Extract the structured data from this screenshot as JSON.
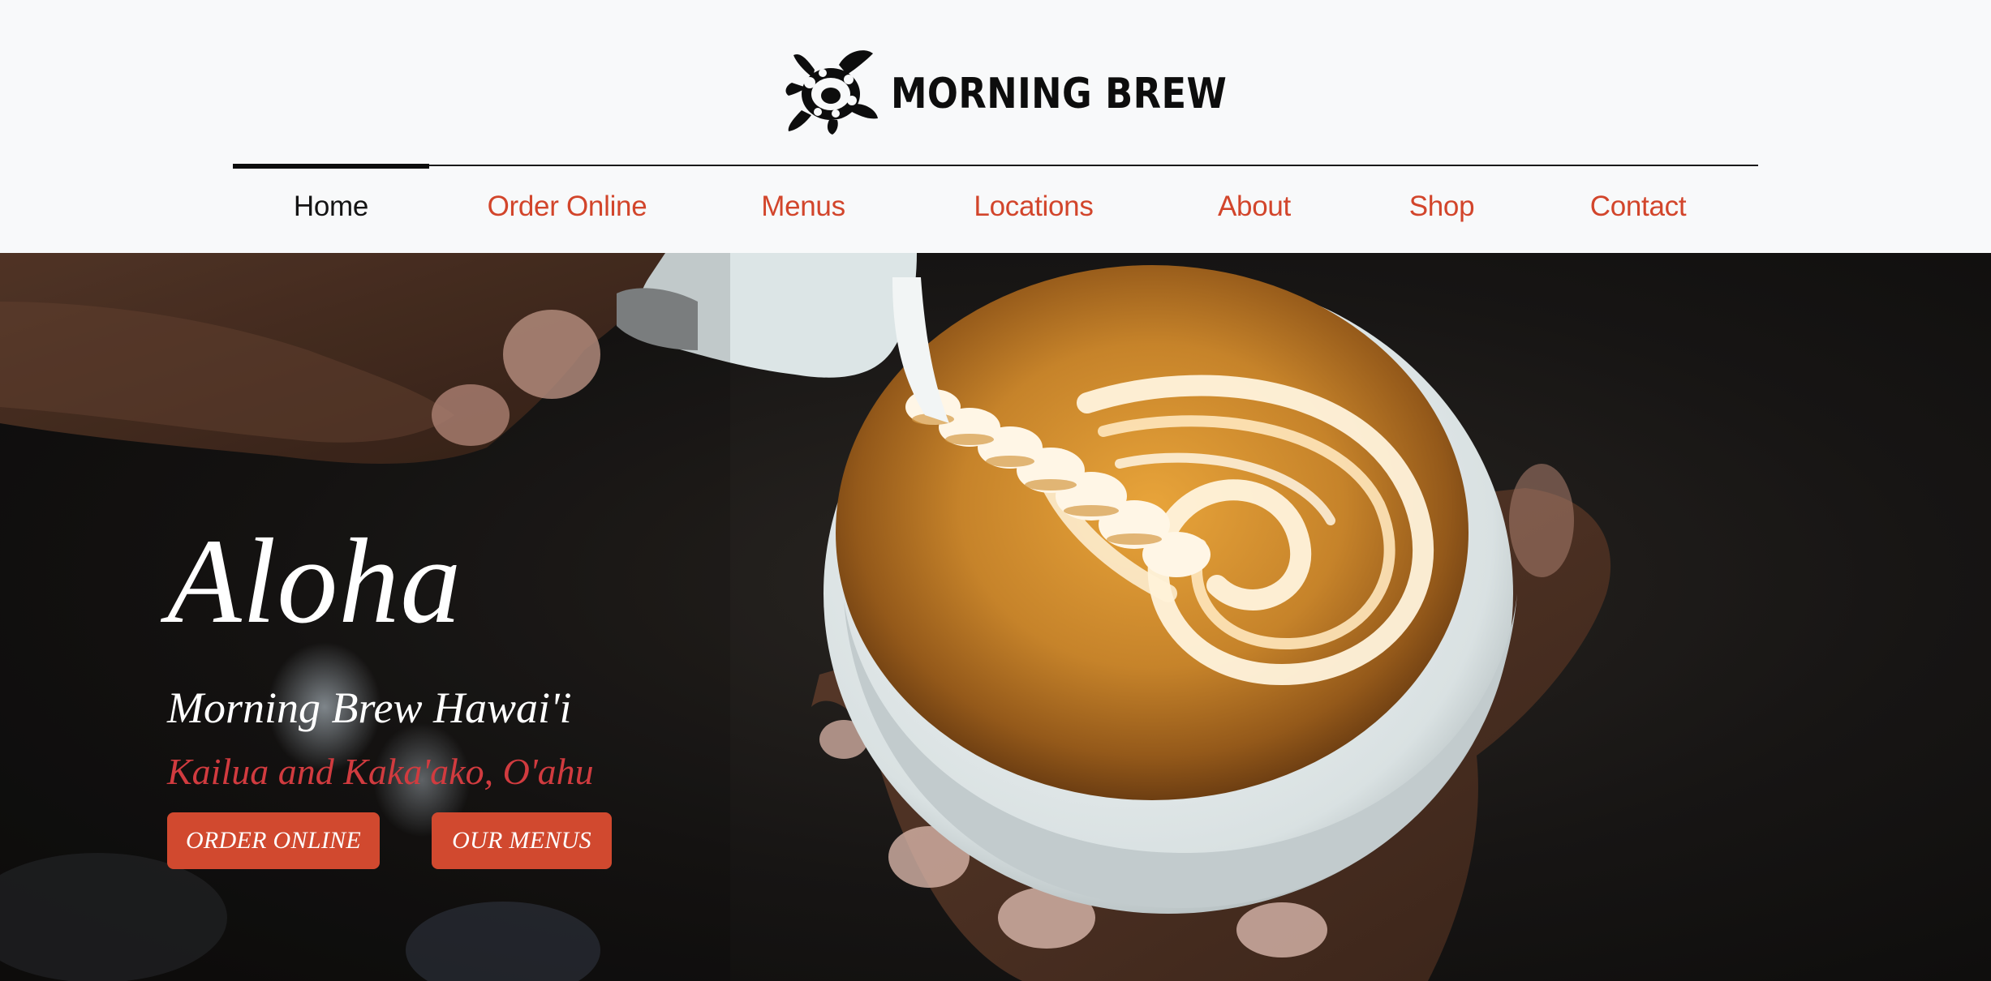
{
  "brand": {
    "name": "MORNING BREW",
    "logo_icon": "turtle-icon"
  },
  "nav": {
    "items": [
      {
        "label": "Home",
        "active": true
      },
      {
        "label": "Order Online",
        "active": false
      },
      {
        "label": "Menus",
        "active": false
      },
      {
        "label": "Locations",
        "active": false
      },
      {
        "label": "About",
        "active": false
      },
      {
        "label": "Shop",
        "active": false
      },
      {
        "label": "Contact",
        "active": false
      }
    ]
  },
  "hero": {
    "title": "Aloha",
    "subtitle": "Morning Brew Hawai'i",
    "location": "Kailua and Kaka'ako, O'ahu",
    "buttons": {
      "order_online": "ORDER ONLINE",
      "our_menus": "OUR MENUS"
    }
  },
  "colors": {
    "accent": "#d1492f",
    "location_text": "#d13b3f",
    "header_bg": "#f8f9fa",
    "nav_active": "#141414"
  }
}
